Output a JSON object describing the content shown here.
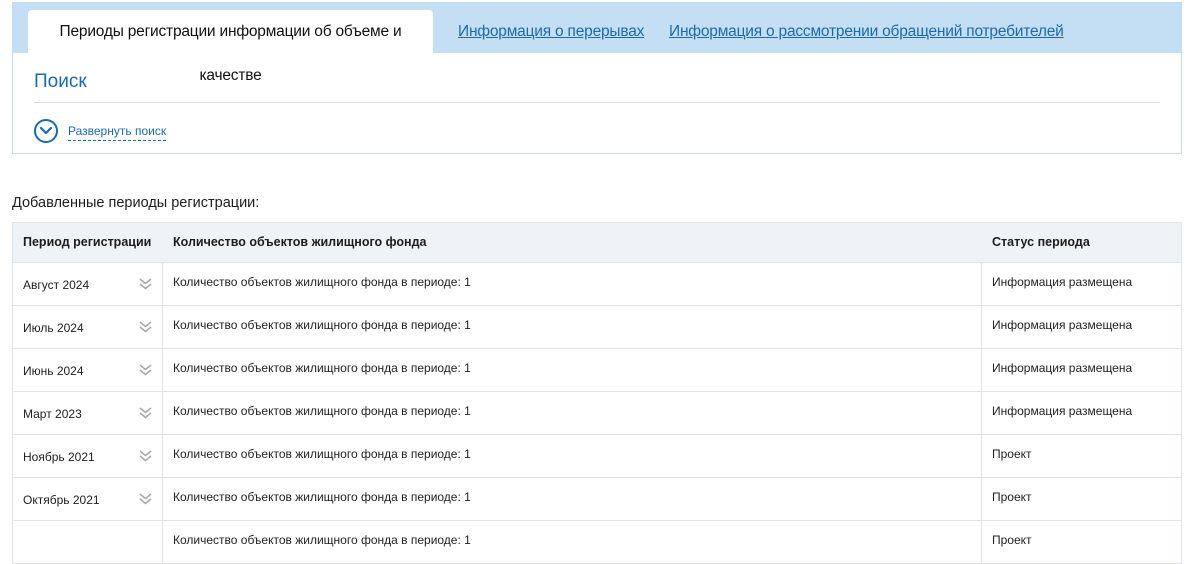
{
  "tabs": {
    "active": "Периоды регистрации информации об объеме и качестве",
    "breaks": "Информация о перерывах",
    "appeals": "Информация о рассмотрении обращений потребителей"
  },
  "search": {
    "title": "Поиск",
    "expand_label": "Развернуть поиск"
  },
  "periods": {
    "caption": "Добавленные периоды регистрации:",
    "headers": {
      "period": "Период регистрации",
      "count": "Количество объектов жилищного фонда",
      "status": "Статус периода"
    },
    "rows": [
      {
        "period": "Август 2024",
        "count": "Количество объектов жилищного фонда в периоде: 1",
        "status": "Информация размещена"
      },
      {
        "period": "Июль 2024",
        "count": "Количество объектов жилищного фонда в периоде: 1",
        "status": "Информация размещена"
      },
      {
        "period": "Июнь 2024",
        "count": "Количество объектов жилищного фонда в периоде: 1",
        "status": "Информация размещена"
      },
      {
        "period": "Март 2023",
        "count": "Количество объектов жилищного фонда в периоде: 1",
        "status": "Информация размещена"
      },
      {
        "period": "Ноябрь 2021",
        "count": "Количество объектов жилищного фонда в периоде: 1",
        "status": "Проект"
      },
      {
        "period": "Октябрь 2021",
        "count": "Количество объектов жилищного фонда в периоде: 1",
        "status": "Проект"
      },
      {
        "period": "",
        "count": "Количество объектов жилищного фонда в периоде: 1",
        "status": "Проект"
      }
    ]
  },
  "colors": {
    "accent": "#1c6aa9",
    "tabbar": "#c4dff3",
    "header_bg": "#eef3f7"
  },
  "icons": {
    "expand": "chevron-down-circle-icon",
    "row_expand": "double-chevron-down-icon"
  }
}
